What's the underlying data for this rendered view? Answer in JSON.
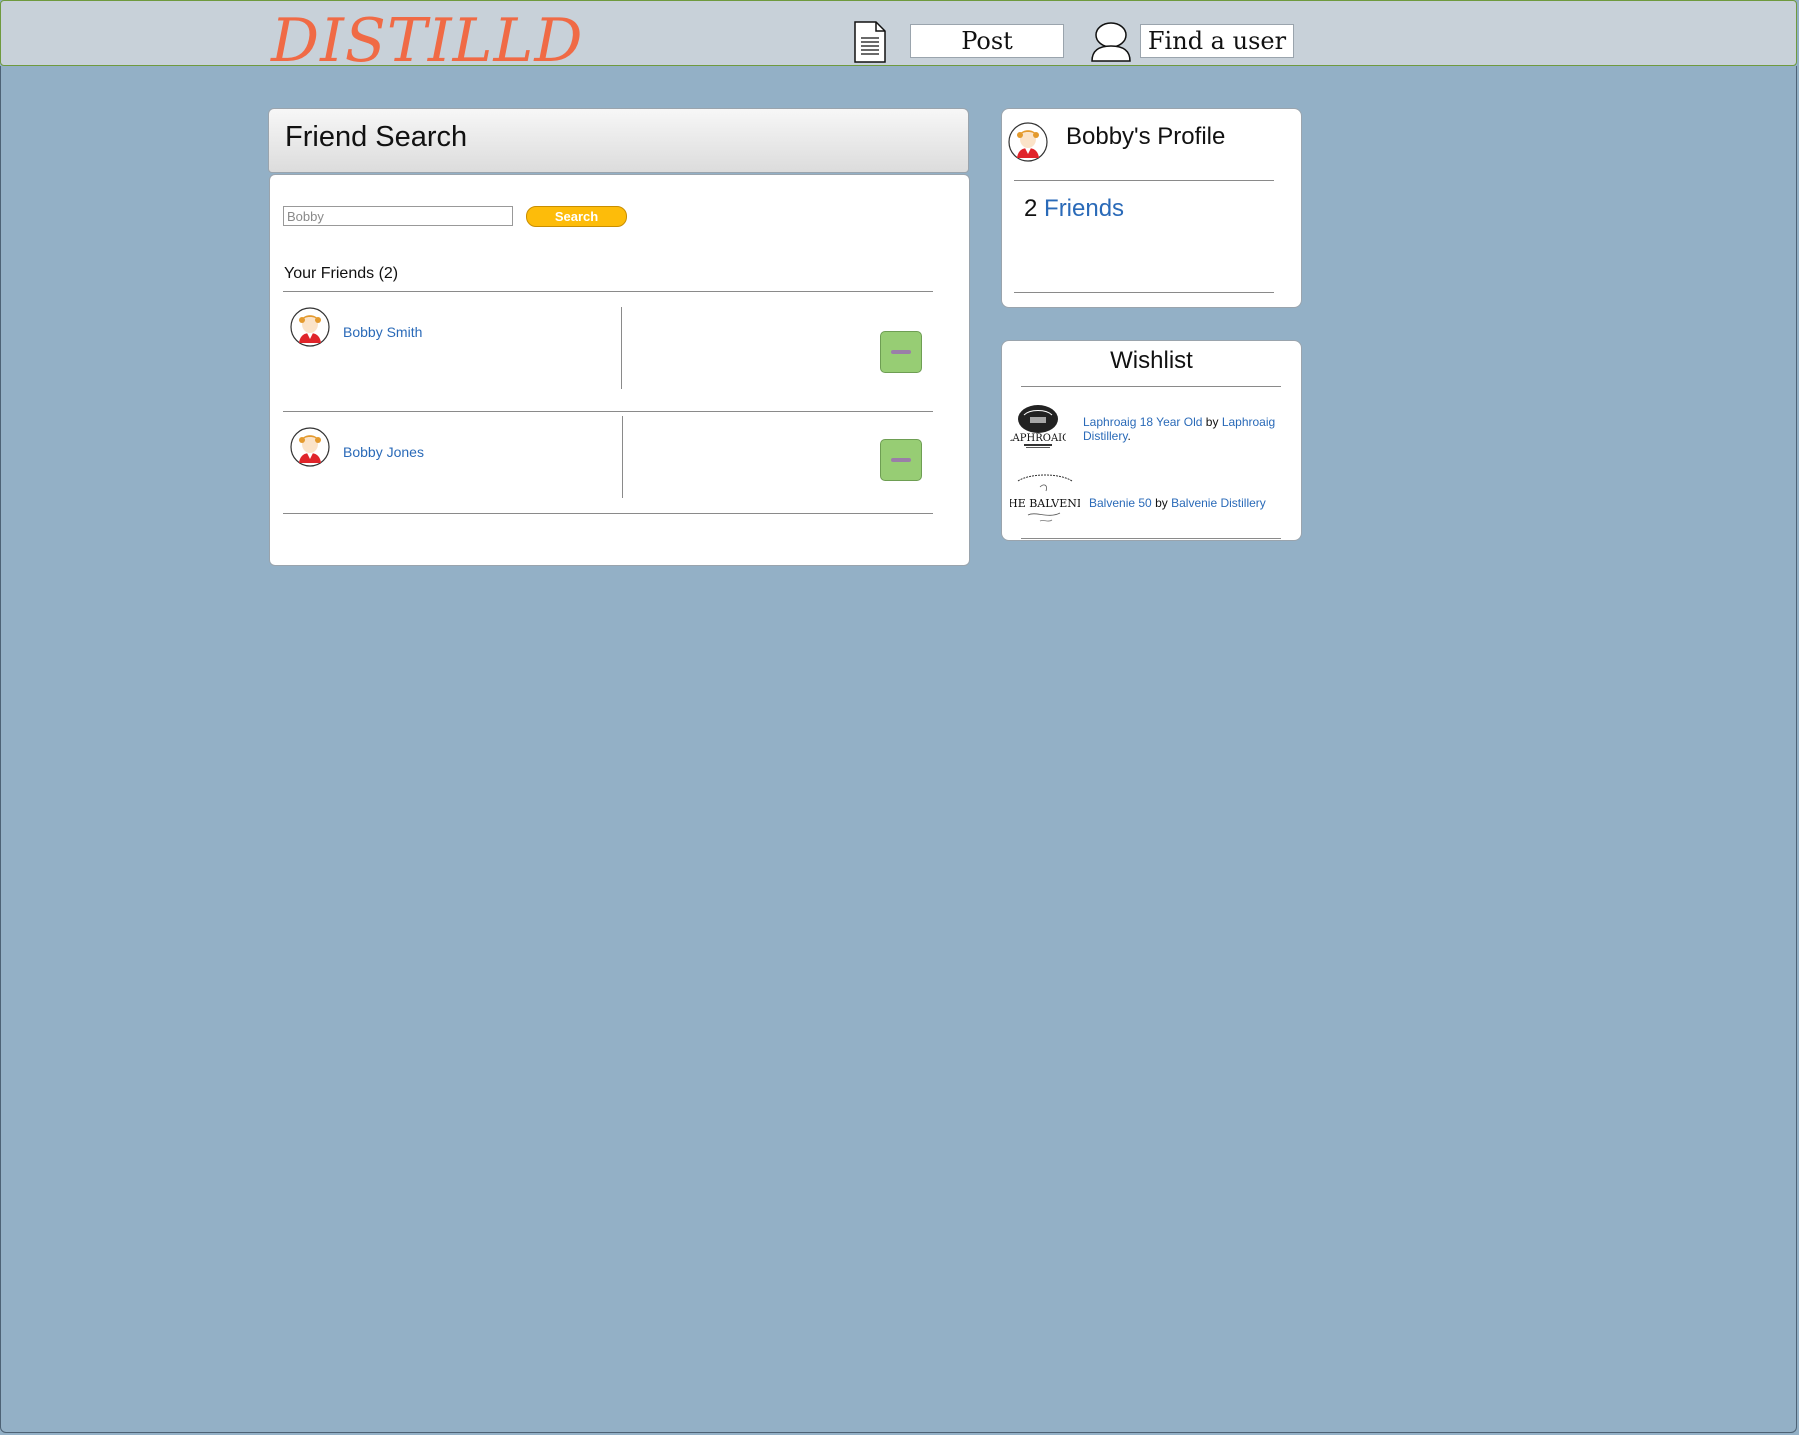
{
  "header": {
    "logo": "DISTILLD",
    "post_label": "Post",
    "find_user_label": "Find a user"
  },
  "friend_search": {
    "title": "Friend Search",
    "search_value": "Bobby",
    "search_button": "Search",
    "friends_header": "Your Friends (2)",
    "friends": [
      {
        "name": "Bobby Smith"
      },
      {
        "name": "Bobby Jones"
      }
    ]
  },
  "profile": {
    "title": "Bobby's Profile",
    "friend_count": "2",
    "friends_link": "Friends"
  },
  "wishlist": {
    "title": "Wishlist",
    "items": [
      {
        "product": "Laphroaig 18 Year Old",
        "by": "by",
        "maker": "Laphroaig Distillery",
        "suffix": ".",
        "logo_text": "LAPHROAIG"
      },
      {
        "product": "Balvenie 50",
        "by": "by",
        "maker": "Balvenie Distillery",
        "logo_text": "THE BALVENIE"
      }
    ]
  },
  "colors": {
    "background": "#93b0c6",
    "logo": "#f06a45",
    "link": "#2a6ab8",
    "search_button": "#fdbc0a",
    "remove_button": "#97cd74"
  }
}
